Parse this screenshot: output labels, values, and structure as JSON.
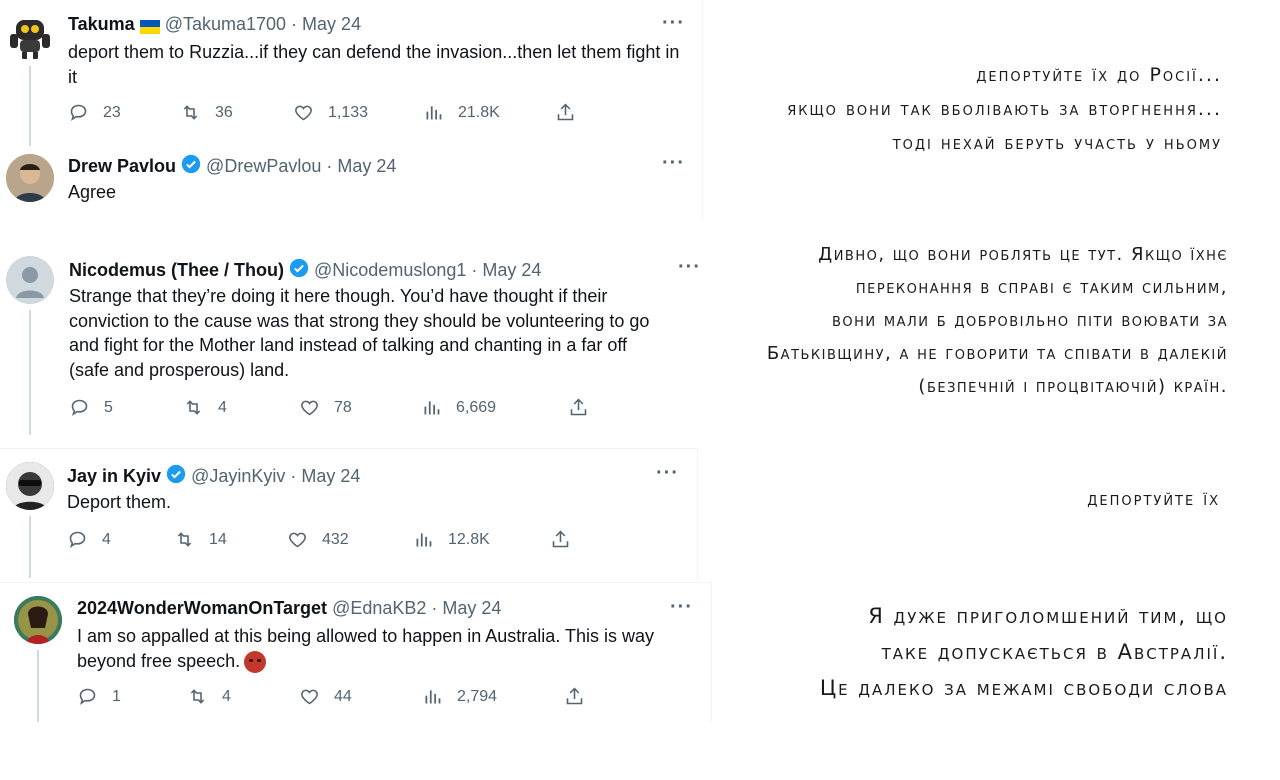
{
  "tweets": [
    {
      "name": "Takuma",
      "has_flag": "ukraine-flag",
      "handle": "@Takuma1700",
      "dot": "·",
      "date": "May 24",
      "text": "deport them to Ruzzia...if they can defend the invasion...then let them fight in it",
      "replies": "23",
      "retweets": "36",
      "likes": "1,133",
      "views": "21.8K",
      "translation": [
        "депортуйте їх до Росії...",
        "якщо вони так вболівають за вторгнення...",
        "тоді нехай беруть участь у ньому"
      ]
    },
    {
      "name": "Drew Pavlou",
      "verified": true,
      "handle": "@DrewPavlou",
      "dot": "·",
      "date": "May 24",
      "text": "Agree"
    },
    {
      "name": "Nicodemus (Thee / Thou)",
      "verified": true,
      "handle": "@Nicodemuslong1",
      "dot": "·",
      "date": "May 24",
      "text_lines": [
        "Strange that they’re doing it here though. You’d have thought if their",
        "conviction to the cause was that strong they should be volunteering to go",
        "and fight for the Mother land instead of talking and chanting in a far off",
        "(safe and prosperous) land."
      ],
      "replies": "5",
      "retweets": "4",
      "likes": "78",
      "views": "6,669",
      "translation": [
        "Дивно, що вони роблять це тут.  Якщо їхнє",
        "переконання в справі є таким сильним,",
        "вони мали б добровільно піти воювати за",
        "Батьківщину, а не говорити та співати в далекій",
        "(безпечній і процвітаючій) країн."
      ]
    },
    {
      "name": "Jay in Kyiv",
      "verified": true,
      "handle": "@JayinKyiv",
      "dot": "·",
      "date": "May 24",
      "text": "Deport them.",
      "replies": "4",
      "retweets": "14",
      "likes": "432",
      "views": "12.8K",
      "translation": [
        "депортуйте їх"
      ]
    },
    {
      "name": "2024WonderWomanOnTarget",
      "handle": "@EdnaKB2",
      "dot": "·",
      "date": "May 24",
      "text_lines": [
        "I am so appalled at this being allowed to happen in Australia. This is way",
        "beyond free speech."
      ],
      "emoji": "angry-face-emoji",
      "replies": "1",
      "retweets": "4",
      "likes": "44",
      "views": "2,794",
      "translation": [
        "Я дуже приголомшений тим, що",
        "таке допускається в Австралії.",
        "Це далеко за межамі свободи слова"
      ]
    }
  ],
  "more_glyph": "···",
  "colors": {
    "text": "#0f1419",
    "secondary": "#536471",
    "verified": "#1d9bf0",
    "border": "#eff3f4"
  }
}
